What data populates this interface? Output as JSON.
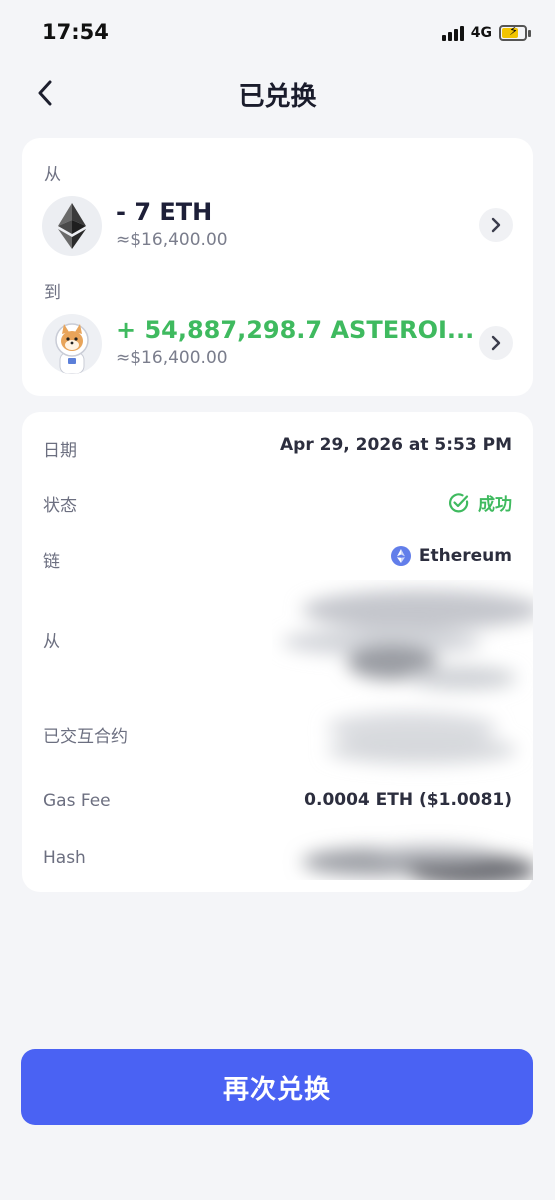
{
  "status_bar": {
    "time": "17:54",
    "network": "4G"
  },
  "nav": {
    "title": "已兑换"
  },
  "swap": {
    "from_label": "从",
    "from_token": {
      "amount": "- 7 ETH",
      "usd": "≈$16,400.00",
      "icon": "ethereum-logo-icon"
    },
    "to_label": "到",
    "to_token": {
      "amount": "+ 54,887,298.7 ASTEROI...",
      "usd": "≈$16,400.00",
      "icon": "shiba-astronaut-icon"
    }
  },
  "details": {
    "date_label": "日期",
    "date_value": "Apr 29, 2026 at 5:53 PM",
    "status_label": "状态",
    "status_value": "成功",
    "chain_label": "链",
    "chain_value": "Ethereum",
    "from_label": "从",
    "contract_label": "已交互合约",
    "gas_label": "Gas Fee",
    "gas_value": "0.0004 ETH ($1.0081)",
    "hash_label": "Hash"
  },
  "colors": {
    "accent": "#4a62f3",
    "success": "#3fba5f",
    "background": "#f4f5f8"
  },
  "cta": {
    "label": "再次兑换"
  }
}
